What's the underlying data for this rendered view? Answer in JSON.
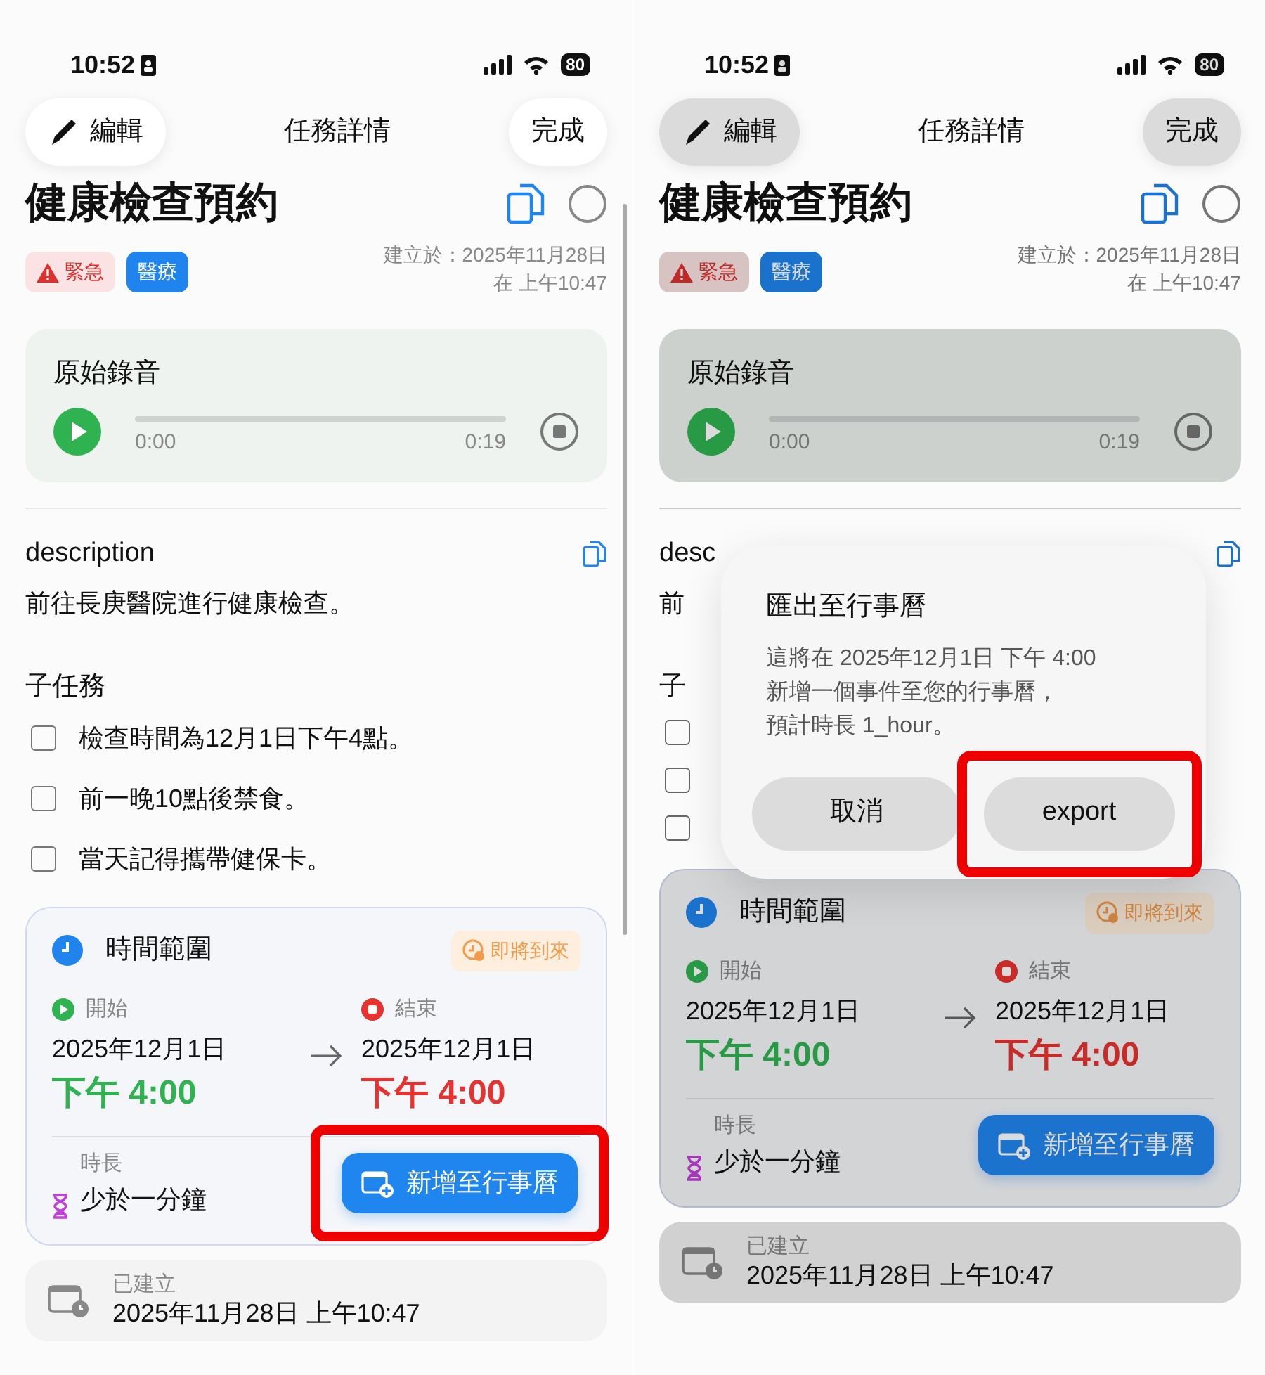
{
  "screens": [
    {
      "dimmed": false,
      "status_bar": {
        "time": "10:52",
        "battery": "80"
      },
      "nav": {
        "edit_button": "編輯",
        "title": "任務詳情",
        "done_button": "完成"
      },
      "task": {
        "title": "健康檢查預約",
        "completed": false,
        "tags": [
          {
            "label": "緊急",
            "kind": "urgent"
          },
          {
            "label": "醫療",
            "kind": "category"
          }
        ],
        "created_line_1": "建立於：2025年11月28日",
        "created_line_2": "在 上午10:47"
      },
      "recording": {
        "title": "原始錄音",
        "elapsed": "0:00",
        "total": "0:19",
        "level": 0
      },
      "description": {
        "label": "description",
        "text": "前往長庚醫院進行健康檢查。"
      },
      "subtasks": {
        "heading": "子任務",
        "items": [
          {
            "text": "檢查時間為12月1日下午4點。",
            "checked": false
          },
          {
            "text": "前一晚10點後禁食。",
            "checked": false
          },
          {
            "text": "當天記得攜帶健保卡。",
            "checked": false
          }
        ]
      },
      "time_range": {
        "title": "時間範圍",
        "status": "即將到來",
        "start_label": "開始",
        "start_date": "2025年12月1日",
        "start_time": "下午 4:00",
        "end_label": "結束",
        "end_date": "2025年12月1日",
        "end_time": "下午 4:00",
        "duration_label": "時長",
        "duration": "少於一分鐘",
        "add_button": "新增至行事曆",
        "add_button_highlighted": true
      },
      "created": {
        "label": "已建立",
        "value": "2025年11月28日 上午10:47"
      }
    },
    {
      "dimmed": true,
      "status_bar": {
        "time": "10:52",
        "battery": "80"
      },
      "nav": {
        "edit_button": "編輯",
        "title": "任務詳情",
        "done_button": "完成"
      },
      "task": {
        "title": "健康檢查預約",
        "completed": false,
        "tags": [
          {
            "label": "緊急",
            "kind": "urgent"
          },
          {
            "label": "醫療",
            "kind": "category"
          }
        ],
        "created_line_1": "建立於：2025年11月28日",
        "created_line_2": "在 上午10:47"
      },
      "recording": {
        "title": "原始錄音",
        "elapsed": "0:00",
        "total": "0:19",
        "level": 0
      },
      "description": {
        "label": "desc",
        "text": "前"
      },
      "subtasks": {
        "heading": "子",
        "items": [
          {
            "checked": false
          },
          {
            "checked": false
          },
          {
            "checked": false
          }
        ]
      },
      "time_range": {
        "title": "時間範圍",
        "status": "即將到來",
        "start_label": "開始",
        "start_date": "2025年12月1日",
        "start_time": "下午 4:00",
        "end_label": "結束",
        "end_date": "2025年12月1日",
        "end_time": "下午 4:00",
        "duration_label": "時長",
        "duration": "少於一分鐘",
        "add_button": "新增至行事曆",
        "add_button_highlighted": false
      },
      "created": {
        "label": "已建立",
        "value": "2025年11月28日 上午10:47"
      },
      "alert": {
        "title": "匯出至行事曆",
        "message_lines": [
          "這將在 2025年12月1日 下午 4:00",
          "新增一個事件至您的行事曆，",
          "預計時長 1_hour。"
        ],
        "buttons": [
          {
            "label": "取消",
            "highlighted": false
          },
          {
            "label": "export",
            "highlighted": true
          }
        ]
      }
    }
  ]
}
